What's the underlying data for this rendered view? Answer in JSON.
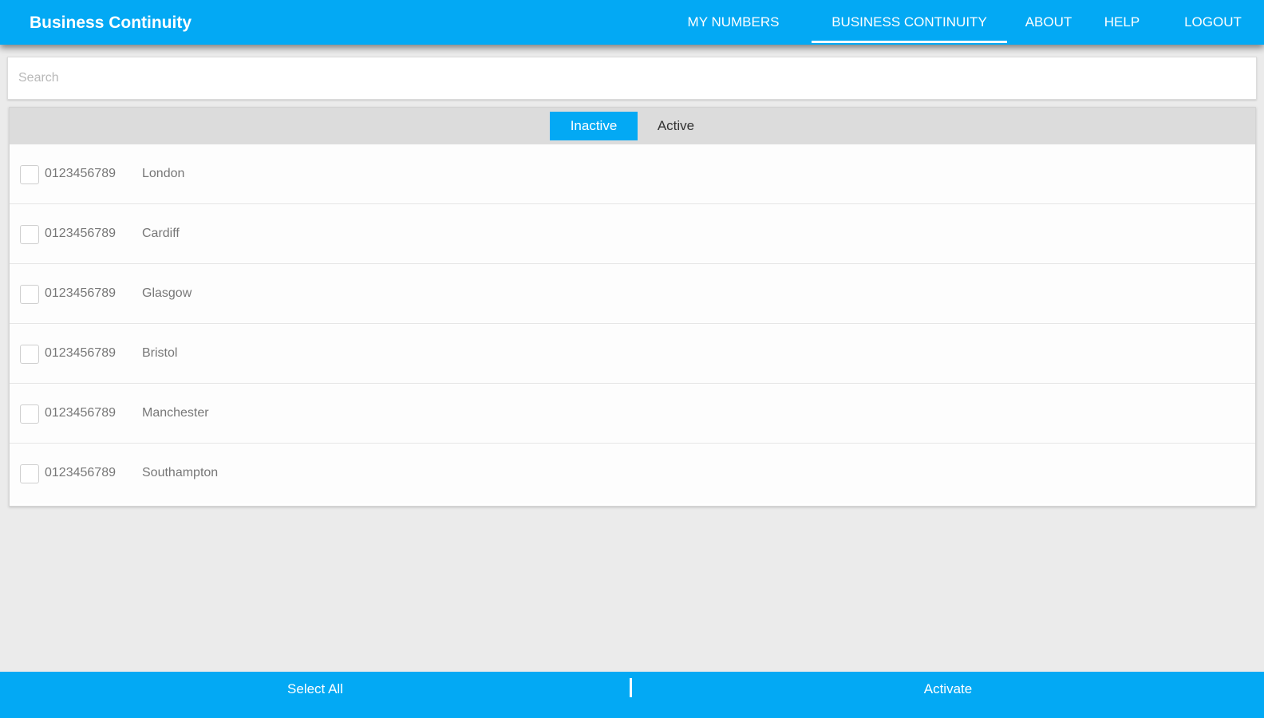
{
  "app": {
    "title": "Business Continuity"
  },
  "nav": {
    "items": [
      {
        "label": "MY NUMBERS",
        "active": false
      },
      {
        "label": "BUSINESS CONTINUITY",
        "active": true
      },
      {
        "label": "ABOUT",
        "active": false
      },
      {
        "label": "HELP",
        "active": false
      },
      {
        "label": "LOGOUT",
        "active": false
      }
    ]
  },
  "search": {
    "placeholder": "Search",
    "value": ""
  },
  "tabs": {
    "inactive_label": "Inactive",
    "active_label": "Active",
    "selected": "Inactive"
  },
  "numbers": [
    {
      "number": "0123456789",
      "city": "London",
      "checked": false
    },
    {
      "number": "0123456789",
      "city": "Cardiff",
      "checked": false
    },
    {
      "number": "0123456789",
      "city": "Glasgow",
      "checked": false
    },
    {
      "number": "0123456789",
      "city": "Bristol",
      "checked": false
    },
    {
      "number": "0123456789",
      "city": "Manchester",
      "checked": false
    },
    {
      "number": "0123456789",
      "city": "Southampton",
      "checked": false
    }
  ],
  "footer": {
    "select_all_label": "Select All",
    "activate_label": "Activate"
  },
  "colors": {
    "primary": "#03a9f4",
    "background": "#ebebeb",
    "tabbar": "#dcdcdc"
  }
}
